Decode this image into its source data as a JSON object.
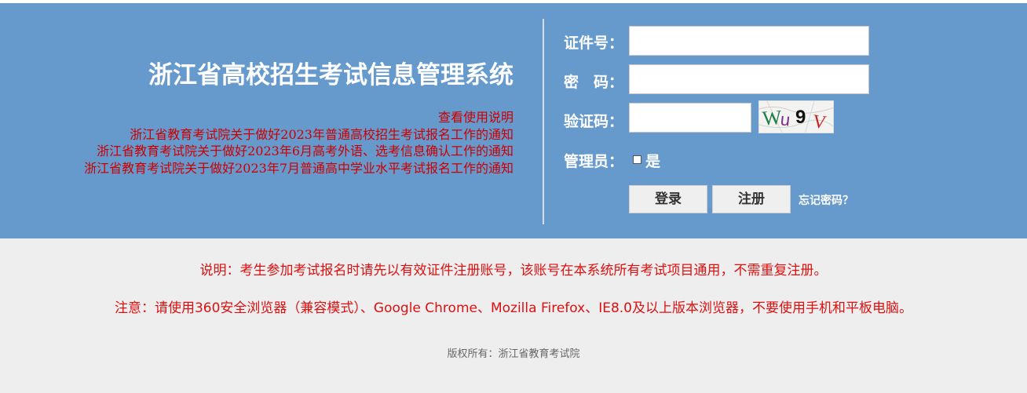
{
  "system_title": "浙江省高校招生考试信息管理系统",
  "links": [
    "查看使用说明",
    "浙江省教育考试院关于做好2023年普通高校招生考试报名工作的通知",
    "浙江省教育考试院关于做好2023年6月高考外语、选考信息确认工作的通知",
    "浙江省教育考试院关于做好2023年7月普通高中学业水平考试报名工作的通知"
  ],
  "login_form": {
    "id_label": "证件号：",
    "id_value": "",
    "password_label": "密　码：",
    "password_value": "",
    "captcha_label": "验证码：",
    "captcha_value": "",
    "captcha_chars": [
      "W",
      "u",
      "9",
      "V"
    ],
    "admin_label": "管理员：",
    "admin_option": "是",
    "admin_checked": false,
    "login_button": "登录",
    "register_button": "注册",
    "forgot_password": "忘记密码？"
  },
  "notes": {
    "explanation": "说明：考生参加考试报名时请先以有效证件注册账号，该账号在本系统所有考试项目通用，不需重复注册。",
    "attention": "注意：请使用360安全浏览器（兼容模式）、Google Chrome、Mozilla Firefox、IE8.0及以上版本浏览器，不要使用手机和平板电脑。"
  },
  "copyright": "版权所有：浙江省教育考试院",
  "colors": {
    "banner": "#6699cc",
    "link_red": "#cc0000",
    "notice_red": "#dd1111",
    "page_bg": "#eeeeee"
  }
}
